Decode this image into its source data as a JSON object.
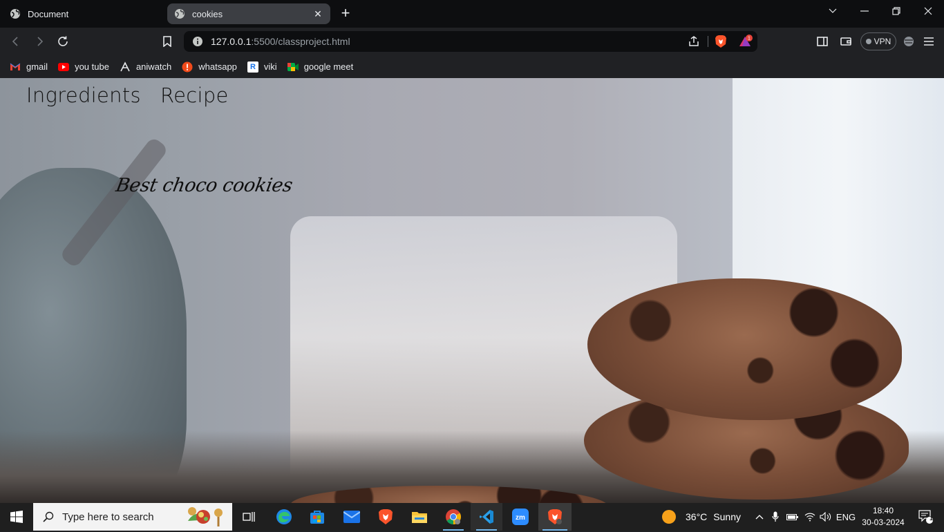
{
  "browser": {
    "tabs": [
      {
        "title": "Document",
        "active": false
      },
      {
        "title": "cookies",
        "active": true
      }
    ],
    "url": {
      "host": "127.0.0.1",
      "rest": ":5500/classproject.html"
    },
    "rewards_badge": "1",
    "vpn_label": "VPN"
  },
  "bookmarks": [
    {
      "label": "gmail",
      "icon": "gmail-icon"
    },
    {
      "label": "you tube",
      "icon": "youtube-icon"
    },
    {
      "label": "aniwatch",
      "icon": "aniwatch-icon"
    },
    {
      "label": "whatsapp",
      "icon": "whatsapp-icon"
    },
    {
      "label": "viki",
      "icon": "viki-icon"
    },
    {
      "label": "google meet",
      "icon": "google-meet-icon"
    }
  ],
  "page": {
    "nav": {
      "ingredients": "Ingredients",
      "recipe": "Recipe"
    },
    "hero_title": "Best choco cookies"
  },
  "taskbar": {
    "search_placeholder": "Type here to search",
    "weather": {
      "temp": "36°C",
      "condition": "Sunny"
    },
    "language": "ENG",
    "time": "18:40",
    "date": "30-03-2024",
    "notification_count": "1"
  },
  "colors": {
    "accent": "#76b9ed",
    "brave": "#fb542b"
  }
}
